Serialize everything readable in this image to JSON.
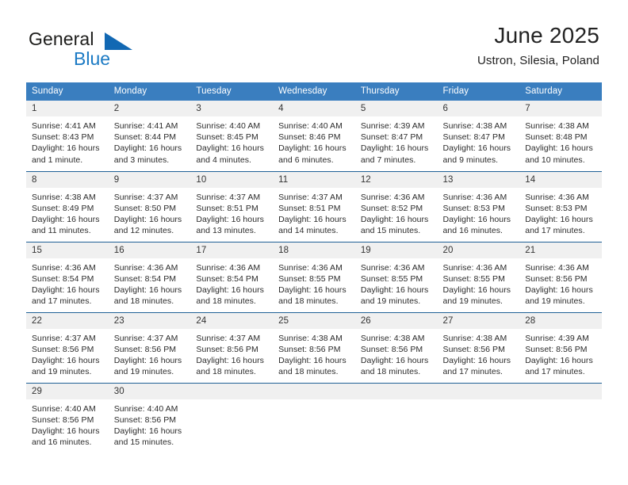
{
  "brand": {
    "name_top": "General",
    "name_bottom": "Blue",
    "accent_color": "#1b7ac4",
    "triangle_color": "#1268b3"
  },
  "header": {
    "title": "June 2025",
    "subtitle": "Ustron, Silesia, Poland"
  },
  "theme": {
    "header_row_bg": "#3a7ebf",
    "daynum_bg": "#f0f0f0",
    "row_border": "#1f6096",
    "text": "#222222"
  },
  "calendar": {
    "weekday_headers": [
      "Sunday",
      "Monday",
      "Tuesday",
      "Wednesday",
      "Thursday",
      "Friday",
      "Saturday"
    ],
    "weeks": [
      [
        {
          "day": "1",
          "sunrise": "Sunrise: 4:41 AM",
          "sunset": "Sunset: 8:43 PM",
          "daylight_1": "Daylight: 16 hours",
          "daylight_2": "and 1 minute."
        },
        {
          "day": "2",
          "sunrise": "Sunrise: 4:41 AM",
          "sunset": "Sunset: 8:44 PM",
          "daylight_1": "Daylight: 16 hours",
          "daylight_2": "and 3 minutes."
        },
        {
          "day": "3",
          "sunrise": "Sunrise: 4:40 AM",
          "sunset": "Sunset: 8:45 PM",
          "daylight_1": "Daylight: 16 hours",
          "daylight_2": "and 4 minutes."
        },
        {
          "day": "4",
          "sunrise": "Sunrise: 4:40 AM",
          "sunset": "Sunset: 8:46 PM",
          "daylight_1": "Daylight: 16 hours",
          "daylight_2": "and 6 minutes."
        },
        {
          "day": "5",
          "sunrise": "Sunrise: 4:39 AM",
          "sunset": "Sunset: 8:47 PM",
          "daylight_1": "Daylight: 16 hours",
          "daylight_2": "and 7 minutes."
        },
        {
          "day": "6",
          "sunrise": "Sunrise: 4:38 AM",
          "sunset": "Sunset: 8:47 PM",
          "daylight_1": "Daylight: 16 hours",
          "daylight_2": "and 9 minutes."
        },
        {
          "day": "7",
          "sunrise": "Sunrise: 4:38 AM",
          "sunset": "Sunset: 8:48 PM",
          "daylight_1": "Daylight: 16 hours",
          "daylight_2": "and 10 minutes."
        }
      ],
      [
        {
          "day": "8",
          "sunrise": "Sunrise: 4:38 AM",
          "sunset": "Sunset: 8:49 PM",
          "daylight_1": "Daylight: 16 hours",
          "daylight_2": "and 11 minutes."
        },
        {
          "day": "9",
          "sunrise": "Sunrise: 4:37 AM",
          "sunset": "Sunset: 8:50 PM",
          "daylight_1": "Daylight: 16 hours",
          "daylight_2": "and 12 minutes."
        },
        {
          "day": "10",
          "sunrise": "Sunrise: 4:37 AM",
          "sunset": "Sunset: 8:51 PM",
          "daylight_1": "Daylight: 16 hours",
          "daylight_2": "and 13 minutes."
        },
        {
          "day": "11",
          "sunrise": "Sunrise: 4:37 AM",
          "sunset": "Sunset: 8:51 PM",
          "daylight_1": "Daylight: 16 hours",
          "daylight_2": "and 14 minutes."
        },
        {
          "day": "12",
          "sunrise": "Sunrise: 4:36 AM",
          "sunset": "Sunset: 8:52 PM",
          "daylight_1": "Daylight: 16 hours",
          "daylight_2": "and 15 minutes."
        },
        {
          "day": "13",
          "sunrise": "Sunrise: 4:36 AM",
          "sunset": "Sunset: 8:53 PM",
          "daylight_1": "Daylight: 16 hours",
          "daylight_2": "and 16 minutes."
        },
        {
          "day": "14",
          "sunrise": "Sunrise: 4:36 AM",
          "sunset": "Sunset: 8:53 PM",
          "daylight_1": "Daylight: 16 hours",
          "daylight_2": "and 17 minutes."
        }
      ],
      [
        {
          "day": "15",
          "sunrise": "Sunrise: 4:36 AM",
          "sunset": "Sunset: 8:54 PM",
          "daylight_1": "Daylight: 16 hours",
          "daylight_2": "and 17 minutes."
        },
        {
          "day": "16",
          "sunrise": "Sunrise: 4:36 AM",
          "sunset": "Sunset: 8:54 PM",
          "daylight_1": "Daylight: 16 hours",
          "daylight_2": "and 18 minutes."
        },
        {
          "day": "17",
          "sunrise": "Sunrise: 4:36 AM",
          "sunset": "Sunset: 8:54 PM",
          "daylight_1": "Daylight: 16 hours",
          "daylight_2": "and 18 minutes."
        },
        {
          "day": "18",
          "sunrise": "Sunrise: 4:36 AM",
          "sunset": "Sunset: 8:55 PM",
          "daylight_1": "Daylight: 16 hours",
          "daylight_2": "and 18 minutes."
        },
        {
          "day": "19",
          "sunrise": "Sunrise: 4:36 AM",
          "sunset": "Sunset: 8:55 PM",
          "daylight_1": "Daylight: 16 hours",
          "daylight_2": "and 19 minutes."
        },
        {
          "day": "20",
          "sunrise": "Sunrise: 4:36 AM",
          "sunset": "Sunset: 8:55 PM",
          "daylight_1": "Daylight: 16 hours",
          "daylight_2": "and 19 minutes."
        },
        {
          "day": "21",
          "sunrise": "Sunrise: 4:36 AM",
          "sunset": "Sunset: 8:56 PM",
          "daylight_1": "Daylight: 16 hours",
          "daylight_2": "and 19 minutes."
        }
      ],
      [
        {
          "day": "22",
          "sunrise": "Sunrise: 4:37 AM",
          "sunset": "Sunset: 8:56 PM",
          "daylight_1": "Daylight: 16 hours",
          "daylight_2": "and 19 minutes."
        },
        {
          "day": "23",
          "sunrise": "Sunrise: 4:37 AM",
          "sunset": "Sunset: 8:56 PM",
          "daylight_1": "Daylight: 16 hours",
          "daylight_2": "and 19 minutes."
        },
        {
          "day": "24",
          "sunrise": "Sunrise: 4:37 AM",
          "sunset": "Sunset: 8:56 PM",
          "daylight_1": "Daylight: 16 hours",
          "daylight_2": "and 18 minutes."
        },
        {
          "day": "25",
          "sunrise": "Sunrise: 4:38 AM",
          "sunset": "Sunset: 8:56 PM",
          "daylight_1": "Daylight: 16 hours",
          "daylight_2": "and 18 minutes."
        },
        {
          "day": "26",
          "sunrise": "Sunrise: 4:38 AM",
          "sunset": "Sunset: 8:56 PM",
          "daylight_1": "Daylight: 16 hours",
          "daylight_2": "and 18 minutes."
        },
        {
          "day": "27",
          "sunrise": "Sunrise: 4:38 AM",
          "sunset": "Sunset: 8:56 PM",
          "daylight_1": "Daylight: 16 hours",
          "daylight_2": "and 17 minutes."
        },
        {
          "day": "28",
          "sunrise": "Sunrise: 4:39 AM",
          "sunset": "Sunset: 8:56 PM",
          "daylight_1": "Daylight: 16 hours",
          "daylight_2": "and 17 minutes."
        }
      ],
      [
        {
          "day": "29",
          "sunrise": "Sunrise: 4:40 AM",
          "sunset": "Sunset: 8:56 PM",
          "daylight_1": "Daylight: 16 hours",
          "daylight_2": "and 16 minutes."
        },
        {
          "day": "30",
          "sunrise": "Sunrise: 4:40 AM",
          "sunset": "Sunset: 8:56 PM",
          "daylight_1": "Daylight: 16 hours",
          "daylight_2": "and 15 minutes."
        },
        {
          "day": "",
          "sunrise": "",
          "sunset": "",
          "daylight_1": "",
          "daylight_2": ""
        },
        {
          "day": "",
          "sunrise": "",
          "sunset": "",
          "daylight_1": "",
          "daylight_2": ""
        },
        {
          "day": "",
          "sunrise": "",
          "sunset": "",
          "daylight_1": "",
          "daylight_2": ""
        },
        {
          "day": "",
          "sunrise": "",
          "sunset": "",
          "daylight_1": "",
          "daylight_2": ""
        },
        {
          "day": "",
          "sunrise": "",
          "sunset": "",
          "daylight_1": "",
          "daylight_2": ""
        }
      ]
    ]
  }
}
